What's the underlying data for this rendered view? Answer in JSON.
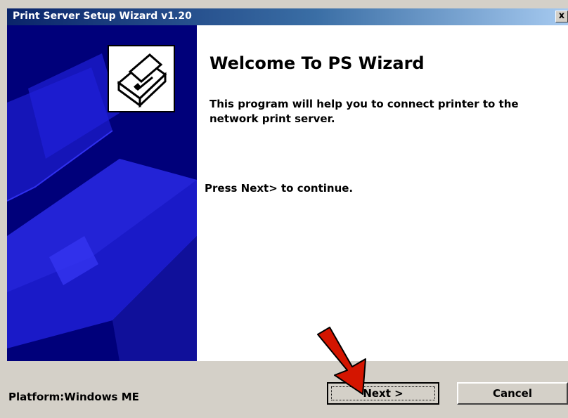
{
  "window": {
    "title": "Print Server Setup Wizard v1.20",
    "close_label": "x"
  },
  "main": {
    "heading": "Welcome To PS Wizard",
    "description": "This program will help you to connect printer to the network print server.",
    "instruction": "Press Next> to continue."
  },
  "footer": {
    "platform": "Platform:Windows ME",
    "next_label": "Next >",
    "cancel_label": "Cancel"
  },
  "icons": {
    "side_art": "printer-illustration",
    "printer": "printer-icon",
    "annotation": "red-arrow-icon"
  },
  "colors": {
    "side_panel": "#00007a",
    "title_bar": "#0a246a",
    "arrow": "#cc1100"
  }
}
